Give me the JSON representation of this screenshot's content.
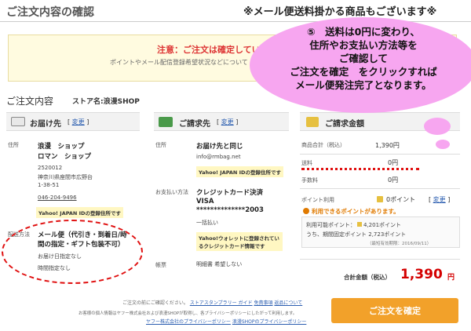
{
  "header": {
    "title": "ご注文内容の確認",
    "notice": "※メール便送料掛かる商品もございます※"
  },
  "warning": {
    "title": "注意：ご注文は確定してい",
    "sub": "ポイントやメール配信登録希望状況などについて"
  },
  "order": {
    "heading": "ご注文内容",
    "store_label": "ストア名:浪漫SHOP"
  },
  "shipping": {
    "title": "お届け先",
    "change": "変更",
    "address_label": "住所",
    "name_lines": [
      "浪漫　ショップ",
      "ロマン　ショップ"
    ],
    "address_lines": [
      "2520012",
      "神奈川県座間市広野台",
      "1-38-51"
    ],
    "phone": "046-204-9496",
    "yahoo_tag": "Yahoo! JAPAN IDの登録住所です",
    "method_label": "配送方法",
    "method_value_1": "メール便（代引き・到着日/時",
    "method_value_2": "間の指定・ギフト包装不可）",
    "date_note": "お届け日指定なし",
    "time_note": "時間指定なし"
  },
  "billing": {
    "title": "ご請求先",
    "change": "変更",
    "address_label": "住所",
    "same_as": "お届け先と同じ",
    "email": "info@rmbag.net",
    "yahoo_tag": "Yahoo! JAPAN IDの登録住所です",
    "payment_label": "お支払い方法",
    "payment_value": "クレジットカード決済",
    "card_brand": "VISA",
    "card_number": "**************2003",
    "installment": "一括払い",
    "wallet_tag_1": "Yahoo!ウォレットに登録されてい",
    "wallet_tag_2": "るクレジットカード情報です",
    "receipt_label": "帳票",
    "receipt_value": "明細書 希望しない"
  },
  "amount": {
    "title": "ご請求金額",
    "subtotal_label": "商品合計（税込）",
    "subtotal_value": "1,390円",
    "shipping_label": "送料",
    "shipping_value": "0円",
    "fee_label": "手数料",
    "fee_value": "0円",
    "point_label": "ポイント利用",
    "point_value": "0ポイント",
    "point_change": "変更",
    "point_note": "利用できるポイントがあります。",
    "available_label": "利用可能ポイント：",
    "available_value": "4,201ポイント",
    "limited_label": "うち、期間固定ポイント",
    "limited_value": "2,723ポイント",
    "limited_expiry": "（最短有効期限：2016/09/11）",
    "total_label": "合計金額（税込）",
    "total_value": "1,390",
    "total_unit": "円"
  },
  "confirm_button": "ご注文を確定",
  "footer": {
    "line1_text": "ご注文の前にご確認ください。",
    "line1_links": [
      "ストアスタンプラリー ガイド",
      "免責事項",
      "返品について"
    ],
    "line2_text": "お客様の個人情報はヤフー株式会社および浪漫SHOPが取得し、各プライバシーポリシーにしたがって利用します。",
    "line3_links": [
      "ヤフー株式会社のプライバシーポリシー",
      "浪漫SHOPのプライバシーポリシー"
    ]
  },
  "bubble": {
    "lines": [
      "⑤　送料は0円に変わり、",
      "住所やお支払い方法等を",
      "ご確認して",
      "ご注文を確定　をクリックすれば",
      "メール便発注完了となります。"
    ]
  },
  "colors": {
    "accent": "#f2a12a",
    "price": "#d40000",
    "bubble": "#f7a6f0",
    "link": "#2a5db0"
  }
}
